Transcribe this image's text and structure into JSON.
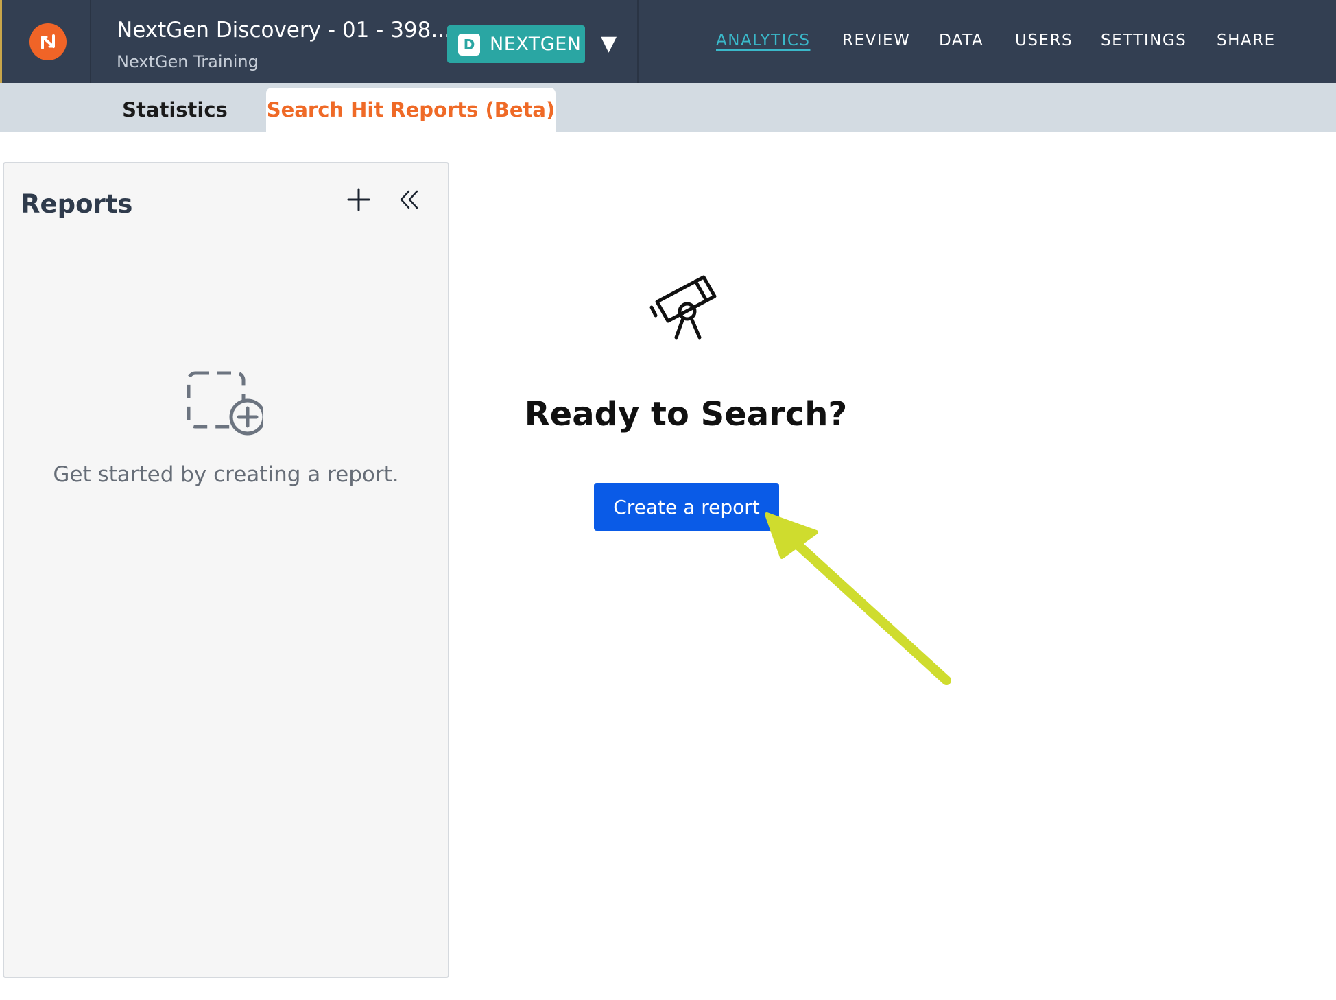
{
  "header": {
    "project_title": "NextGen Discovery - 01 - 398...",
    "project_subtitle": "NextGen Training",
    "badge_letter": "D",
    "badge_label": "NEXTGEN",
    "nav": [
      "ANALYTICS",
      "REVIEW",
      "DATA",
      "USERS",
      "SETTINGS",
      "SHARE"
    ],
    "active_nav": "ANALYTICS"
  },
  "tabs": [
    {
      "label": "Statistics",
      "active": false
    },
    {
      "label": "Search Hit Reports (Beta)",
      "active": true
    }
  ],
  "reports_panel": {
    "title": "Reports",
    "add_icon": "plus-icon",
    "collapse_icon": "double-chevron-left-icon",
    "empty_icon": "dashed-square-add-icon",
    "empty_text": "Get started by creating a report."
  },
  "main": {
    "icon": "telescope-icon",
    "heading": "Ready to Search?",
    "button_label": "Create a report"
  },
  "colors": {
    "topbar": "#333f52",
    "accent_teal": "#2aa6a3",
    "brand_orange": "#f06427",
    "active_tab_text": "#ef6a27",
    "primary_button": "#0a5be7",
    "annotation_arrow": "#cfdc2e"
  }
}
